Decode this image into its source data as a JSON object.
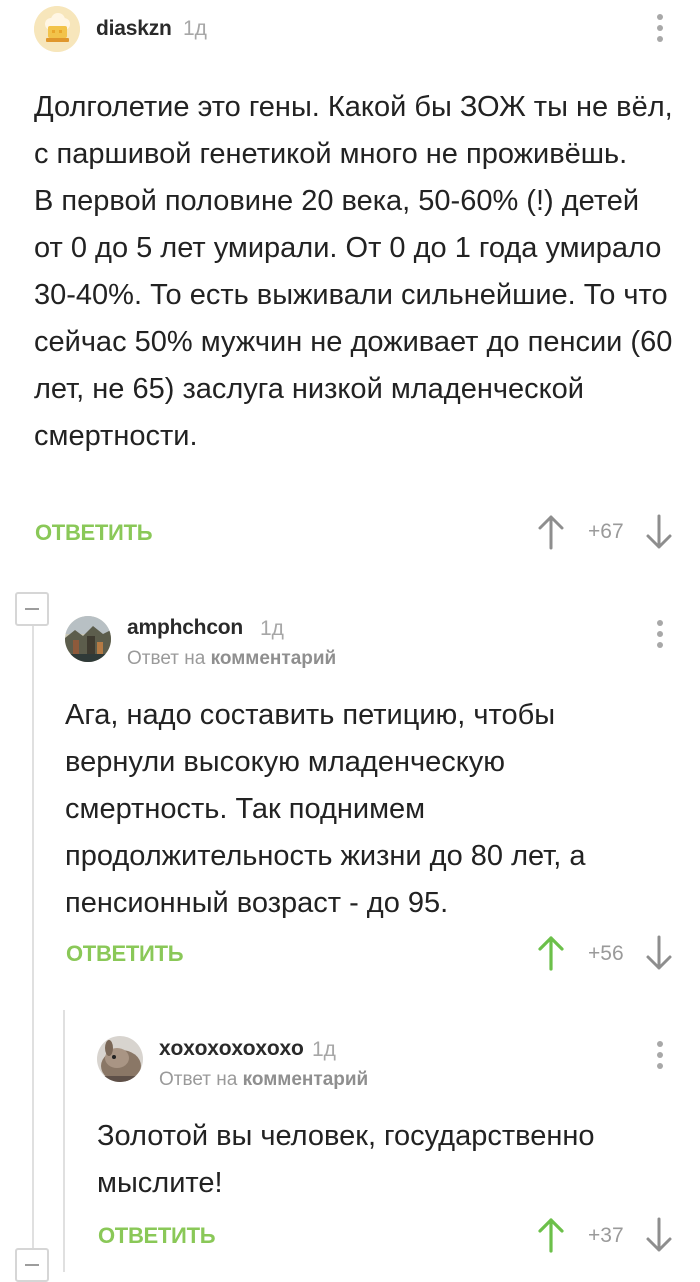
{
  "colors": {
    "reply_green": "#8ac858",
    "upvoted_green": "#6cc04a",
    "arrow_gray": "#8e8e8e",
    "divider": "#e0e0e0"
  },
  "comments": [
    {
      "username": "diaskzn",
      "time": "1д",
      "avatar_icon": "chef-hat-avatar",
      "paragraphs": [
        "Долголетие это гены. Какой бы ЗОЖ ты не вёл, с паршивой генетикой много не проживёшь.",
        "В первой половине 20 века, 50-60% (!) детей от 0 до 5 лет умирали. От 0 до 1 года умирало 30-40%.  То есть выживали сильнейшие. То что сейчас 50% мужчин не доживает до пенсии (60 лет, не 65) заслуга низкой младенческой смертности."
      ],
      "reply_label": "ОТВЕТИТЬ",
      "rating": "+67",
      "upvoted": false
    },
    {
      "username": "amphchcon",
      "time": "1д",
      "avatar_icon": "painting-avatar",
      "reply_prefix": "Ответ на",
      "reply_target": "комментарий",
      "paragraphs": [
        "Ага, надо составить петицию, чтобы вернули высокую младенческую смертность. Так поднимем продолжительность жизни до 80 лет, а пенсионный возраст - до 95."
      ],
      "reply_label": "ОТВЕТИТЬ",
      "rating": "+56",
      "upvoted": true
    },
    {
      "username": "xoxoxoxoxoxo",
      "time": "1д",
      "avatar_icon": "animal-avatar",
      "reply_prefix": "Ответ на",
      "reply_target": "комментарий",
      "paragraphs": [
        "Золотой вы человек, государственно мыслите!"
      ],
      "reply_label": "ОТВЕТИТЬ",
      "rating": "+37",
      "upvoted": true
    }
  ]
}
